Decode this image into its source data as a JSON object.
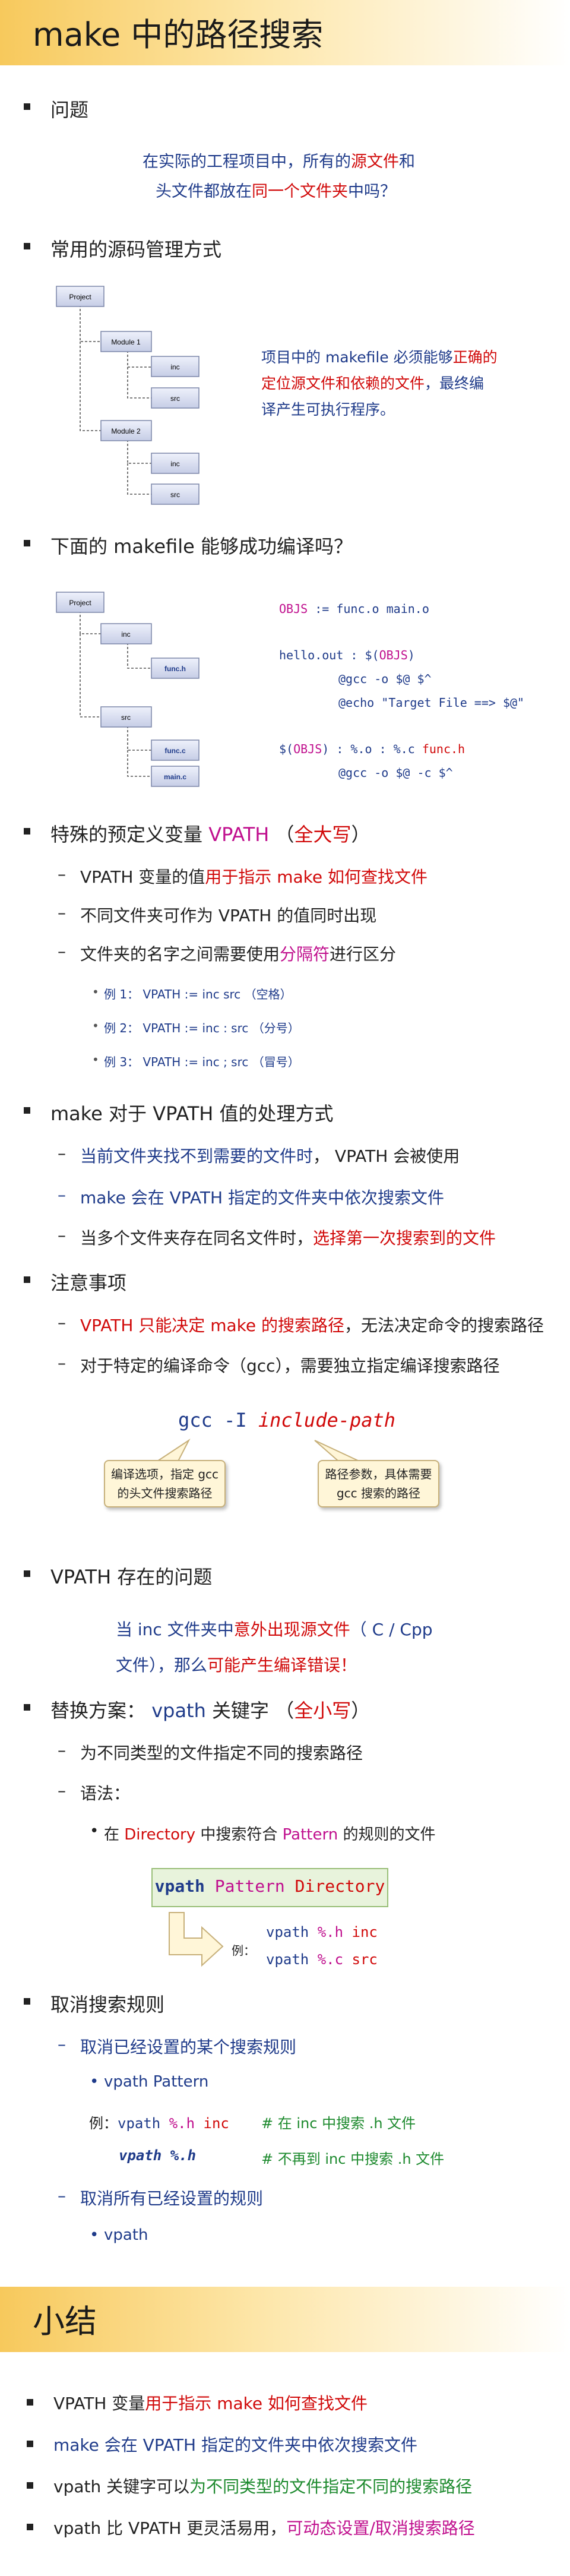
{
  "title1": "make 中的路径搜索",
  "q": {
    "heading": "问题",
    "l1a": "在实际的工程项目中，所有的",
    "l1b": "源文件",
    "l1c": "和",
    "l2a": "头文件",
    "l2b": "都放在",
    "l2c": "同一个文件夹",
    "l2d": "中吗？"
  },
  "common": {
    "heading": "常用的源码管理方式",
    "tree": [
      "Project",
      "Module 1",
      "inc",
      "src",
      "Module 2",
      "inc",
      "src"
    ],
    "d1a": "项目中的 makefile 必须能够",
    "d1b": "正确的",
    "d2a": "定位源文件和依赖的文件",
    "d2b": "，最终编",
    "d3": "译产生可执行程序。"
  },
  "mk": {
    "heading": "下面的 makefile 能够成功编译吗？",
    "tree": [
      "Project",
      "inc",
      "func.h",
      "src",
      "func.c",
      "main.c"
    ],
    "c1a": "OBJS",
    "c1b": " := func.o main.o",
    "c2a": "hello.out : $(",
    "c2b": "OBJS",
    "c2c": ")",
    "c3": "@gcc -o $@ $^",
    "c4": "@echo \"Target File ==> $@\"",
    "c5a": "$(",
    "c5b": "OBJS",
    "c5c": ") : %.o : %.c ",
    "c5d": "func.h",
    "c6": "@gcc -o $@ -c $^"
  },
  "vpath": {
    "heading_a": "特殊的预定义变量 ",
    "heading_b": "VPATH",
    "heading_c": " （",
    "heading_d": "全大写",
    "heading_e": "）",
    "s1a": "VPATH 变量的值",
    "s1b": "用于指示 make 如何查找文件",
    "s2": "不同文件夹可作为 VPATH 的值同时出现",
    "s3a": "文件夹的名字之间需要使用",
    "s3b": "分隔符",
    "s3c": "进行区分",
    "e1": "例 1： VPATH := inc   src   （空格）",
    "e2": "例 2： VPATH := inc : src   （分号）",
    "e3": "例 3： VPATH := inc ; src   （冒号）"
  },
  "proc": {
    "heading": "make 对于 VPATH 值的处理方式",
    "s1a": "当前文件夹找不到需要的文件时",
    "s1b": "， VPATH 会被使用",
    "s2": "make 会在 VPATH 指定的文件夹中依次搜索文件",
    "s3a": "当多个文件夹存在同名文件时，",
    "s3b": "选择第一次搜索到的文件"
  },
  "attn": {
    "heading": "注意事项",
    "s1a": "VPATH 只能决定 make 的搜索路径",
    "s1b": "，无法决定命令的搜索路径",
    "s2": "对于特定的编译命令（gcc），需要独立指定编译搜索路径",
    "gcc_a": "gcc -I ",
    "gcc_b": "include-path",
    "note1": "编译选项，指定 gcc 的头文件搜索路径",
    "note2": "路径参数，具体需要 gcc 搜索的路径"
  },
  "issue": {
    "heading": "VPATH 存在的问题",
    "l1a": "当 inc 文件夹中",
    "l1b": "意外出现源文件",
    "l1c": "（ C / Cpp",
    "l2a": "文件），那么",
    "l2b": "可能产生编译错误！"
  },
  "alt": {
    "heading_a": "替换方案： ",
    "heading_b": "vpath",
    "heading_c": " 关键字 （",
    "heading_d": "全小写",
    "heading_e": "）",
    "s1": "为不同类型的文件指定不同的搜索路径",
    "s2": "语法：",
    "d1a": "在 ",
    "d1b": "Directory",
    "d1c": " 中搜索符合 ",
    "d1d": "Pattern",
    "d1e": " 的规则的文件",
    "box_a": "vpath",
    "box_b": " Pattern ",
    "box_c": "Directory",
    "ex": "例：",
    "ex1a": "vpath ",
    "ex1b": "%.h",
    "ex1c": " inc",
    "ex2a": "vpath ",
    "ex2b": "%.c",
    "ex2c": " src"
  },
  "cancel": {
    "heading": "取消搜索规则",
    "s1": "取消已经设置的某个搜索规则",
    "d1": "vpath Pattern",
    "ex_a": "例：",
    "ex_b": "vpath ",
    "ex_c": "%.h",
    "ex_d": " inc",
    "ex_e": "# 在 inc 中搜索 .h 文件",
    "ex2_a": "vpath %.h",
    "ex2_b": "# 不再到 inc 中搜索 .h 文件",
    "s2": "取消所有已经设置的规则",
    "d2": "vpath"
  },
  "title2": "小结",
  "summary": {
    "b1a": "VPATH 变量",
    "b1b": "用于指示 make 如何查找文件",
    "b2": "make 会在 VPATH 指定的文件夹中依次搜索文件",
    "b3a": "vpath 关键字可以",
    "b3b": "为不同类型的文件指定不同的搜索路径",
    "b4a": "vpath 比 VPATH 更灵活易用，",
    "b4b": "可动态设置/取消搜索路径"
  }
}
